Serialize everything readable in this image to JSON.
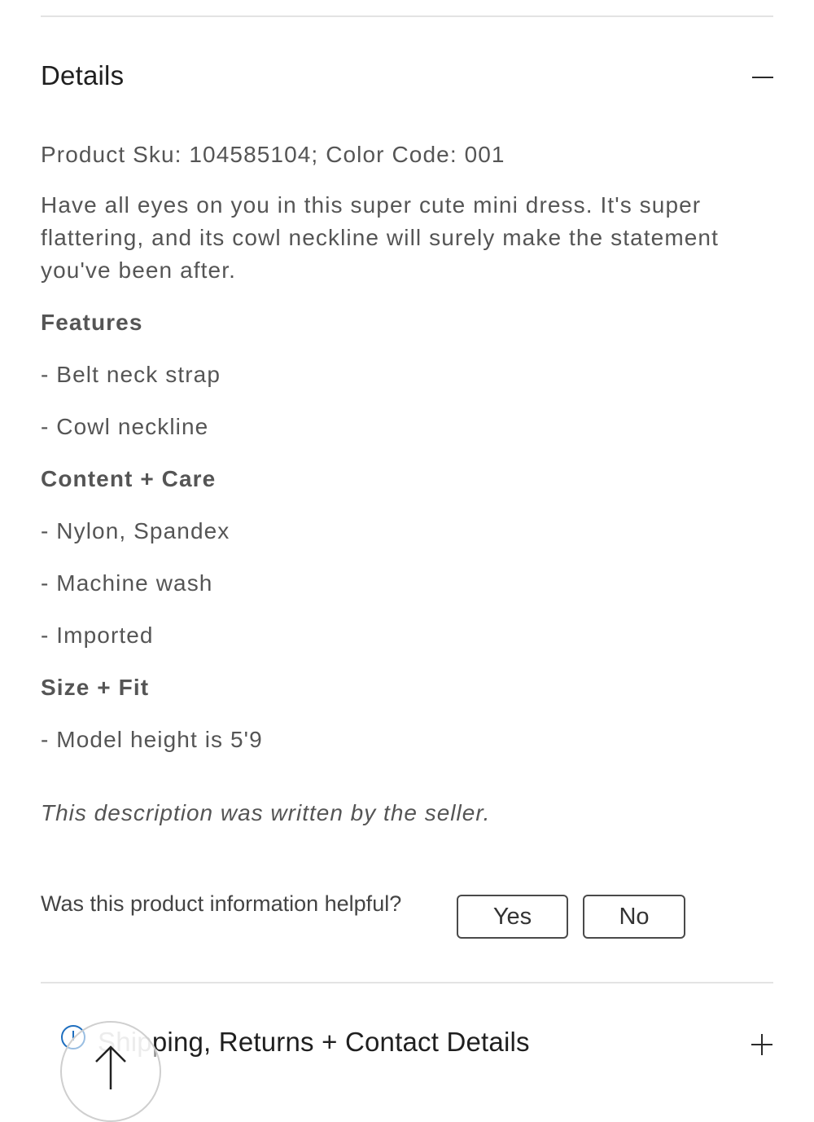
{
  "details": {
    "title": "Details",
    "collapse_icon": "minus-icon",
    "sku_line": "Product Sku: 104585104; Color Code: 001",
    "description": "Have all eyes on you in this super cute mini dress. It's super flattering, and its cowl neckline will surely make the statement you've been after.",
    "features": {
      "heading": "Features",
      "items": [
        "- Belt neck strap",
        "- Cowl neckline"
      ]
    },
    "content_care": {
      "heading": "Content + Care",
      "items": [
        "- Nylon, Spandex",
        "- Machine wash",
        "- Imported"
      ]
    },
    "size_fit": {
      "heading": "Size + Fit",
      "items": [
        "- Model height is 5'9"
      ]
    },
    "seller_note": "This description was written by the seller."
  },
  "feedback": {
    "question": "Was this product information helpful?",
    "yes_label": "Yes",
    "no_label": "No"
  },
  "shipping": {
    "title_faded": "Ship",
    "title_rest": "ping, Returns + Contact Details",
    "expand_icon": "plus-icon",
    "info_icon": "info-icon"
  },
  "back_to_top": {
    "icon": "arrow-up-icon"
  }
}
